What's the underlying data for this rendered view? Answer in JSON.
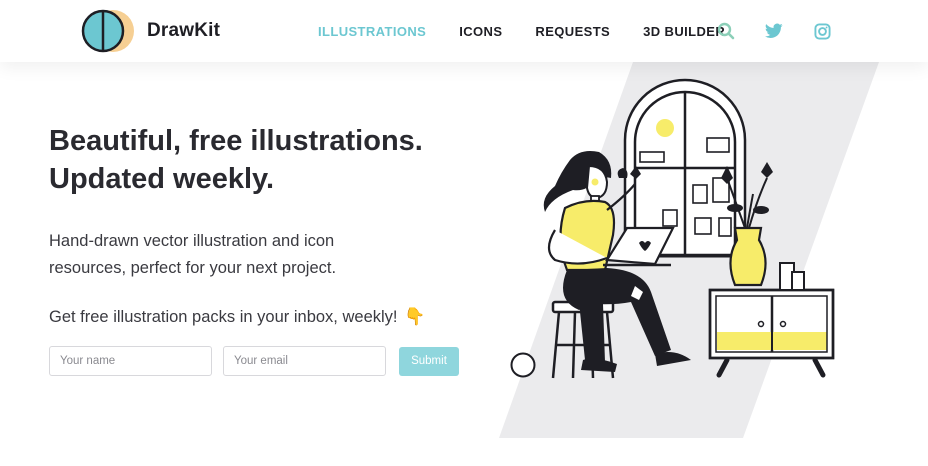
{
  "header": {
    "brand": "DrawKit",
    "nav": [
      {
        "label": "ILLUSTRATIONS",
        "active": true
      },
      {
        "label": "ICONS",
        "active": false
      },
      {
        "label": "REQUESTS",
        "active": false
      },
      {
        "label": "3D BUILDER",
        "active": false
      }
    ],
    "icons": [
      "search-icon",
      "twitter-icon",
      "instagram-icon"
    ]
  },
  "hero": {
    "title_line1": "Beautiful, free illustrations.",
    "title_line2": "Updated weekly.",
    "subtitle": "Hand-drawn vector illustration and icon resources, perfect for your next project.",
    "cta_text": "Get free illustration packs in your inbox, weekly!",
    "cta_emoji": "👇"
  },
  "form": {
    "name_placeholder": "Your name",
    "email_placeholder": "Your email",
    "submit_label": "Submit"
  },
  "colors": {
    "accent": "#6cc7d1",
    "submit_bg": "#8fd6dd",
    "yellow": "#f7ec6a",
    "logo_blue": "#6cc7d1",
    "logo_peach": "#f6cf93"
  }
}
